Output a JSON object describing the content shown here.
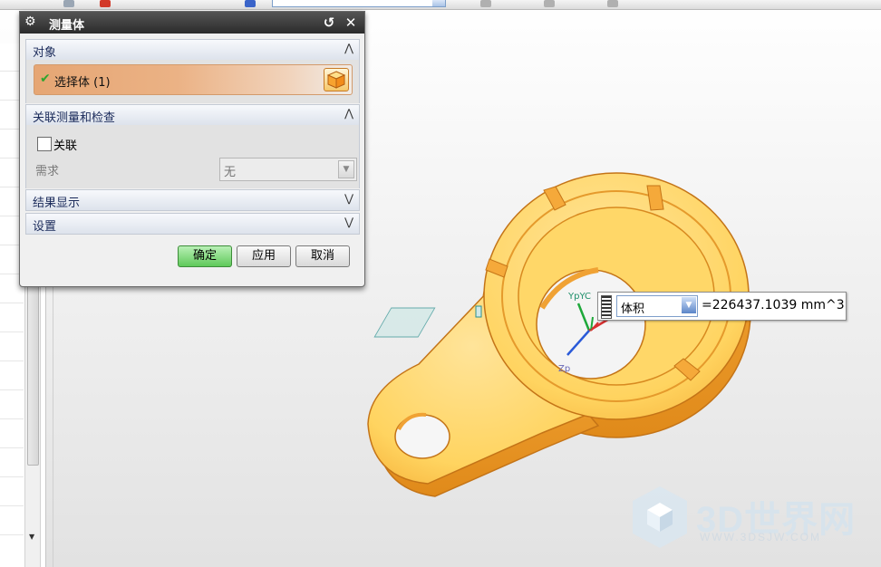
{
  "dialog": {
    "title": "测量体",
    "sections": {
      "object": {
        "label": "对象",
        "select_label": "选择体 (1)"
      },
      "related": {
        "label": "关联测量和检查",
        "assoc_label": "关联",
        "req_label": "需求",
        "req_value": "无"
      },
      "results": {
        "label": "结果显示"
      },
      "settings": {
        "label": "设置"
      }
    },
    "buttons": {
      "ok": "确定",
      "apply": "应用",
      "cancel": "取消"
    }
  },
  "measure": {
    "property": "体积",
    "value": "=226437.1039 mm^3"
  },
  "triad": {
    "y_label": "YpYC",
    "z_label": "Zp"
  },
  "watermark": {
    "title": "3D世界网",
    "url": "WWW.3DSJW.COM"
  },
  "colors": {
    "part": "#ffd76a",
    "part_edge": "#e08a1a",
    "ok_button": "#5fc95a",
    "title_bar": "#2b2b2b"
  }
}
